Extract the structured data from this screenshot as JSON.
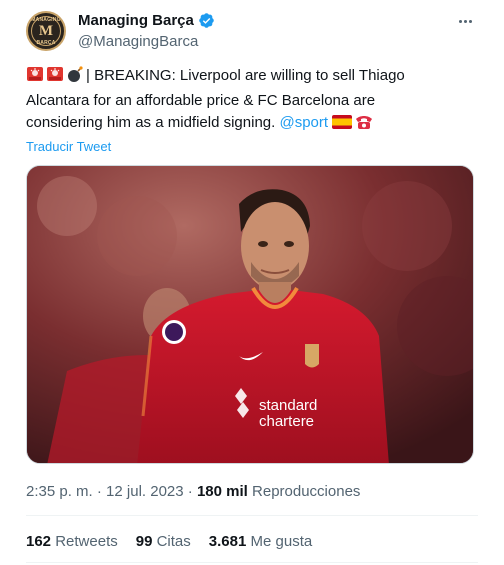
{
  "author": {
    "display_name": "Managing Barça",
    "handle": "@ManagingBarca",
    "avatar_monogram": "M",
    "avatar_text_top": "MANAGING",
    "avatar_text_bottom": "BARÇA",
    "verified": true
  },
  "tweet": {
    "line1_text": "| BREAKING: Liverpool are willing to sell Thiago",
    "line2_text": "Alcantara for an affordable price & FC Barcelona are",
    "line3_text": "considering him as a midfield signing.",
    "mention": "@sport",
    "emojis_start": [
      "police-light-emoji",
      "police-light-emoji",
      "bomb-emoji"
    ],
    "emojis_end": [
      "spain-flag-emoji",
      "telephone-emoji"
    ],
    "translate_label": "Traducir Tweet"
  },
  "media": {
    "sponsor_text_1": "standard",
    "sponsor_text_2": "chartere",
    "colors": {
      "shirt": "#c8102e",
      "background": "#7a2b2f"
    }
  },
  "meta": {
    "time": "2:35 p. m.",
    "date": "12 jul. 2023",
    "separator": "·",
    "views_count": "180 mil",
    "views_label": "Reproducciones"
  },
  "stats": {
    "retweets_count": "162",
    "retweets_label": "Retweets",
    "quotes_count": "99",
    "quotes_label": "Citas",
    "likes_count": "3.681",
    "likes_label": "Me gusta"
  },
  "colors": {
    "accent": "#1d9bf0",
    "text": "#0f1419",
    "secondary_text": "#536471",
    "divider": "#eff3f4"
  }
}
